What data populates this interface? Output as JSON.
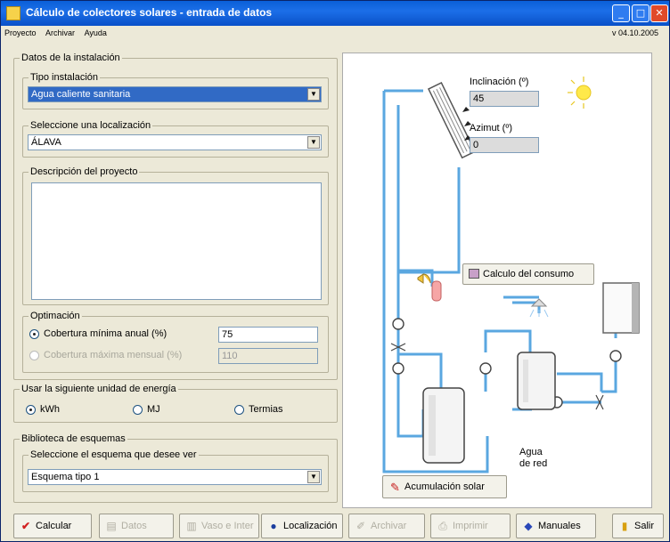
{
  "window": {
    "title": "Cálculo de colectores solares - entrada de datos",
    "version": "v 04.10.2005"
  },
  "menu": [
    "Proyecto",
    "Archivar",
    "Ayuda"
  ],
  "datos": {
    "legend": "Datos de la instalación",
    "tipo_legend": "Tipo instalación",
    "tipo_value": "Agua caliente sanitaria",
    "loc_legend": "Seleccione una localización",
    "loc_value": "ÁLAVA",
    "desc_legend": "Descripción del proyecto",
    "desc_value": ""
  },
  "optimacion": {
    "legend": "Optimación",
    "opt1_label": "Cobertura mínima anual  (%)",
    "opt1_value": "75",
    "opt2_label": "Cobertura máxima mensual (%)",
    "opt2_value": "110"
  },
  "energia": {
    "legend": "Usar la siguiente unidad de energía",
    "options": [
      "kWh",
      "MJ",
      "Termias"
    ],
    "selected": "kWh"
  },
  "biblioteca": {
    "legend": "Biblioteca de esquemas",
    "sub_legend": "Seleccione el esquema que desee ver",
    "value": "Esquema tipo 1"
  },
  "diagram": {
    "inclinacion_label": "Inclinación (º)",
    "inclinacion_value": "45",
    "azimut_label": "Azimut (º)",
    "azimut_value": "0",
    "consumo_button": "Calculo del consumo",
    "agua_label_1": "Agua",
    "agua_label_2": "de red",
    "acumulacion_button": "Acumulación solar"
  },
  "toolbar": {
    "calcular": "Calcular",
    "datos": "Datos",
    "vaso": "Vaso e Inter",
    "localizacion": "Localización",
    "archivar": "Archivar",
    "imprimir": "Imprimir",
    "manuales": "Manuales",
    "salir": "Salir"
  },
  "colors": {
    "pipe": "#5aa7e0",
    "selection": "#316ac5",
    "title": "#0a5fd8"
  }
}
